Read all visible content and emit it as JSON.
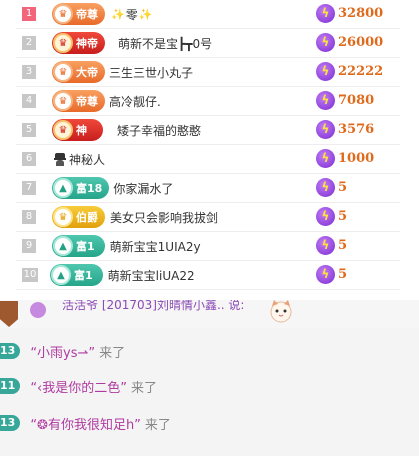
{
  "ranking": [
    {
      "rank": "1",
      "badge": "帝尊",
      "badge_style": "orange",
      "badge_icon": "crown",
      "name": "零",
      "prefix_deco": "✨",
      "suffix_deco": "✨",
      "score": "32800"
    },
    {
      "rank": "2",
      "badge": "神帝",
      "badge_style": "red",
      "badge_icon": "crown",
      "name": "萌新不是宝┣┳0号",
      "score": "26000"
    },
    {
      "rank": "3",
      "badge": "大帝",
      "badge_style": "orange",
      "badge_icon": "crown",
      "name": "三生三世小丸子",
      "score": "22222"
    },
    {
      "rank": "4",
      "badge": "帝尊",
      "badge_style": "orange",
      "badge_icon": "crown",
      "name": "高冷靓仔.",
      "score": "7080"
    },
    {
      "rank": "5",
      "badge": "神",
      "badge_style": "red",
      "badge_icon": "crown",
      "name": "矮子幸福的憨憨",
      "score": "3576"
    },
    {
      "rank": "6",
      "badge": "",
      "badge_style": "mystery",
      "badge_icon": "mystery-person",
      "name": "神秘人",
      "score": "1000"
    },
    {
      "rank": "7",
      "badge": "富18",
      "badge_style": "teal",
      "badge_icon": "triangle",
      "name": "你家漏水了",
      "score": "5"
    },
    {
      "rank": "8",
      "badge": "伯爵",
      "badge_style": "gold",
      "badge_icon": "crown",
      "name": "美女只会影响我拔剑",
      "score": "5"
    },
    {
      "rank": "9",
      "badge": "富1",
      "badge_style": "teal",
      "badge_icon": "triangle",
      "name": "萌新宝宝1UIA2y",
      "score": "5"
    },
    {
      "rank": "10",
      "badge": "富1",
      "badge_style": "teal",
      "badge_icon": "triangle",
      "name": "萌新宝宝liUA22",
      "score": "5"
    }
  ],
  "chat": {
    "partial_line_text": "活活爷 [201703]刘晴情小鑫.. 说:",
    "messages": [
      {
        "level": "13",
        "user": "“小雨ys⇀”",
        "action": "来了"
      },
      {
        "level": "11",
        "user": "“‹我是你的二色”",
        "action": "来了"
      },
      {
        "level": "13",
        "user": "“❂有你我很知足h”",
        "action": "来了"
      }
    ]
  },
  "colors": {
    "score": "#e06a1c",
    "rank_first": "#f2657b",
    "rank_default": "#c7c7c7",
    "chat_user": "#b03aa0",
    "level_badge": "#37a79a"
  }
}
